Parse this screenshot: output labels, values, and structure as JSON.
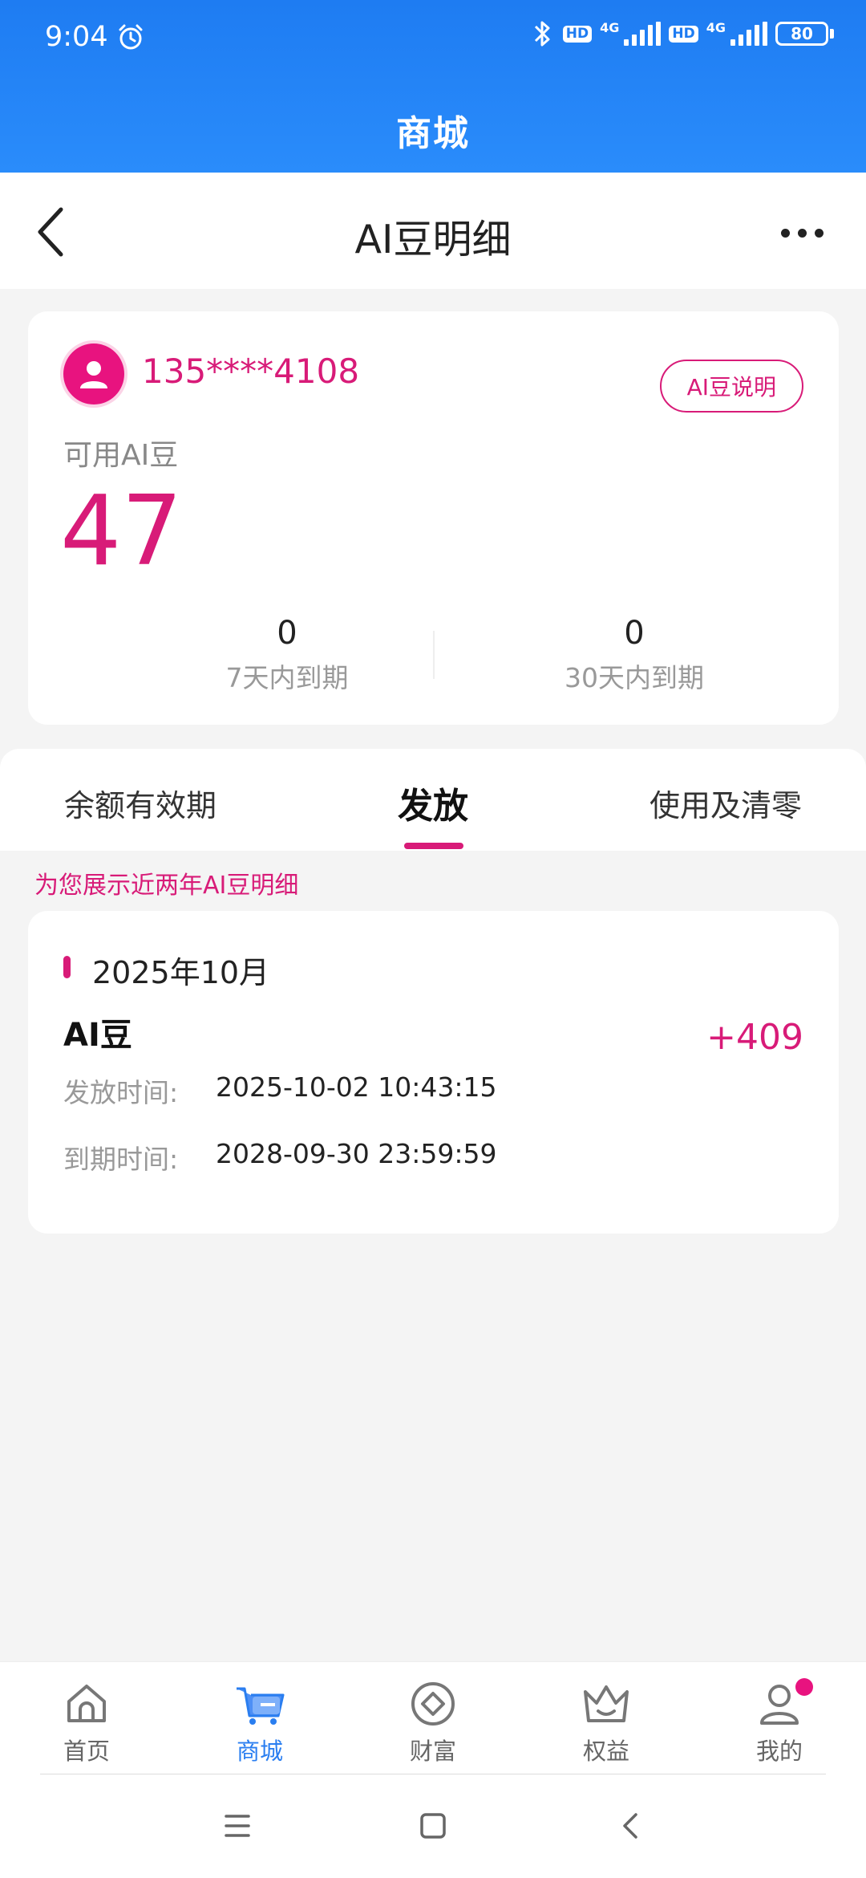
{
  "status_bar": {
    "time": "9:04",
    "network_1": "4G",
    "network_2": "4G",
    "hd_1": "HD",
    "hd_2": "HD",
    "battery": "80"
  },
  "header": {
    "mall_title": "商城"
  },
  "navbar": {
    "title": "AI豆明细"
  },
  "account": {
    "phone": "135****4108",
    "explain_button": "AI豆说明",
    "available_label": "可用AI豆",
    "available_value": "47",
    "expiry": [
      {
        "value": "0",
        "label": "7天内到期"
      },
      {
        "value": "0",
        "label": "30天内到期"
      }
    ]
  },
  "tabs": {
    "balance_validity": "余额有效期",
    "issue": "发放",
    "usage_clear": "使用及清零",
    "active": "issue"
  },
  "notice": "为您展示近两年AI豆明细",
  "records": [
    {
      "month": "2025年10月",
      "name": "AI豆",
      "amount": "+409",
      "issue_time_label": "发放时间:",
      "issue_time": "2025-10-02 10:43:15",
      "expire_time_label": "到期时间:",
      "expire_time": "2028-09-30 23:59:59"
    }
  ],
  "bottom_nav": {
    "items": [
      {
        "label": "首页",
        "icon": "home-icon"
      },
      {
        "label": "商城",
        "icon": "mall-icon"
      },
      {
        "label": "财富",
        "icon": "wealth-icon"
      },
      {
        "label": "权益",
        "icon": "crown-icon"
      },
      {
        "label": "我的",
        "icon": "user-icon"
      }
    ],
    "active_index": 1
  },
  "colors": {
    "brand_blue": "#1e7cf2",
    "accent_magenta": "#d81b78",
    "page_bg": "#f4f4f4"
  }
}
